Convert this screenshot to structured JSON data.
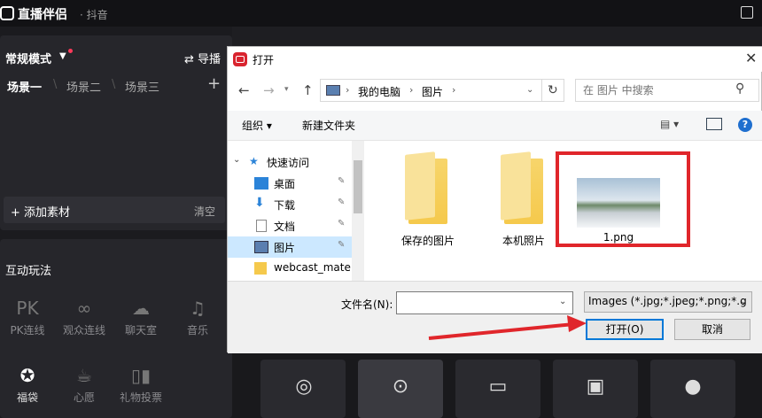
{
  "app": {
    "title": "直播伴侣",
    "platform": "· 抖音"
  },
  "left_panel": {
    "mode_label": "常规模式",
    "director_label": "导播",
    "scenes": [
      "场景一",
      "场景二",
      "场景三"
    ],
    "add_material_label": "添加素材",
    "clear_label": "清空",
    "interact_title": "互动玩法",
    "tools_row1": [
      {
        "label": "PK连线",
        "icon": "pk-icon"
      },
      {
        "label": "观众连线",
        "icon": "link-icon"
      },
      {
        "label": "聊天室",
        "icon": "chat-icon"
      },
      {
        "label": "音乐",
        "icon": "music-icon"
      }
    ],
    "tools_row2": [
      {
        "label": "福袋",
        "icon": "lucky-bag-icon"
      },
      {
        "label": "心愿",
        "icon": "wish-icon"
      },
      {
        "label": "礼物投票",
        "icon": "vote-icon"
      }
    ]
  },
  "dialog": {
    "title": "打开",
    "address": {
      "crumbs": [
        "我的电脑",
        "图片"
      ]
    },
    "search": {
      "placeholder": "在 图片 中搜索"
    },
    "toolbar": {
      "organize_label": "组织 ▾",
      "new_folder_label": "新建文件夹"
    },
    "nav_items": [
      {
        "label": "快速访问",
        "icon": "star-icon"
      },
      {
        "label": "桌面",
        "icon": "desktop-icon"
      },
      {
        "label": "下载",
        "icon": "download-icon"
      },
      {
        "label": "文档",
        "icon": "document-icon"
      },
      {
        "label": "图片",
        "icon": "pictures-icon"
      },
      {
        "label": "webcast_mate",
        "icon": "folder-icon"
      }
    ],
    "files": [
      {
        "label": "保存的图片",
        "type": "folder"
      },
      {
        "label": "本机照片",
        "type": "folder"
      },
      {
        "label": "1.png",
        "type": "image"
      }
    ],
    "filename_label": "文件名(N):",
    "filename_value": "",
    "filetype_value": "Images (*.jpg;*.jpeg;*.png;*.g",
    "open_label": "打开(O)",
    "cancel_label": "取消"
  },
  "colors": {
    "highlight_red": "#e0262b",
    "selected_blue": "#cce8ff",
    "accent_blue": "#0078d7"
  }
}
